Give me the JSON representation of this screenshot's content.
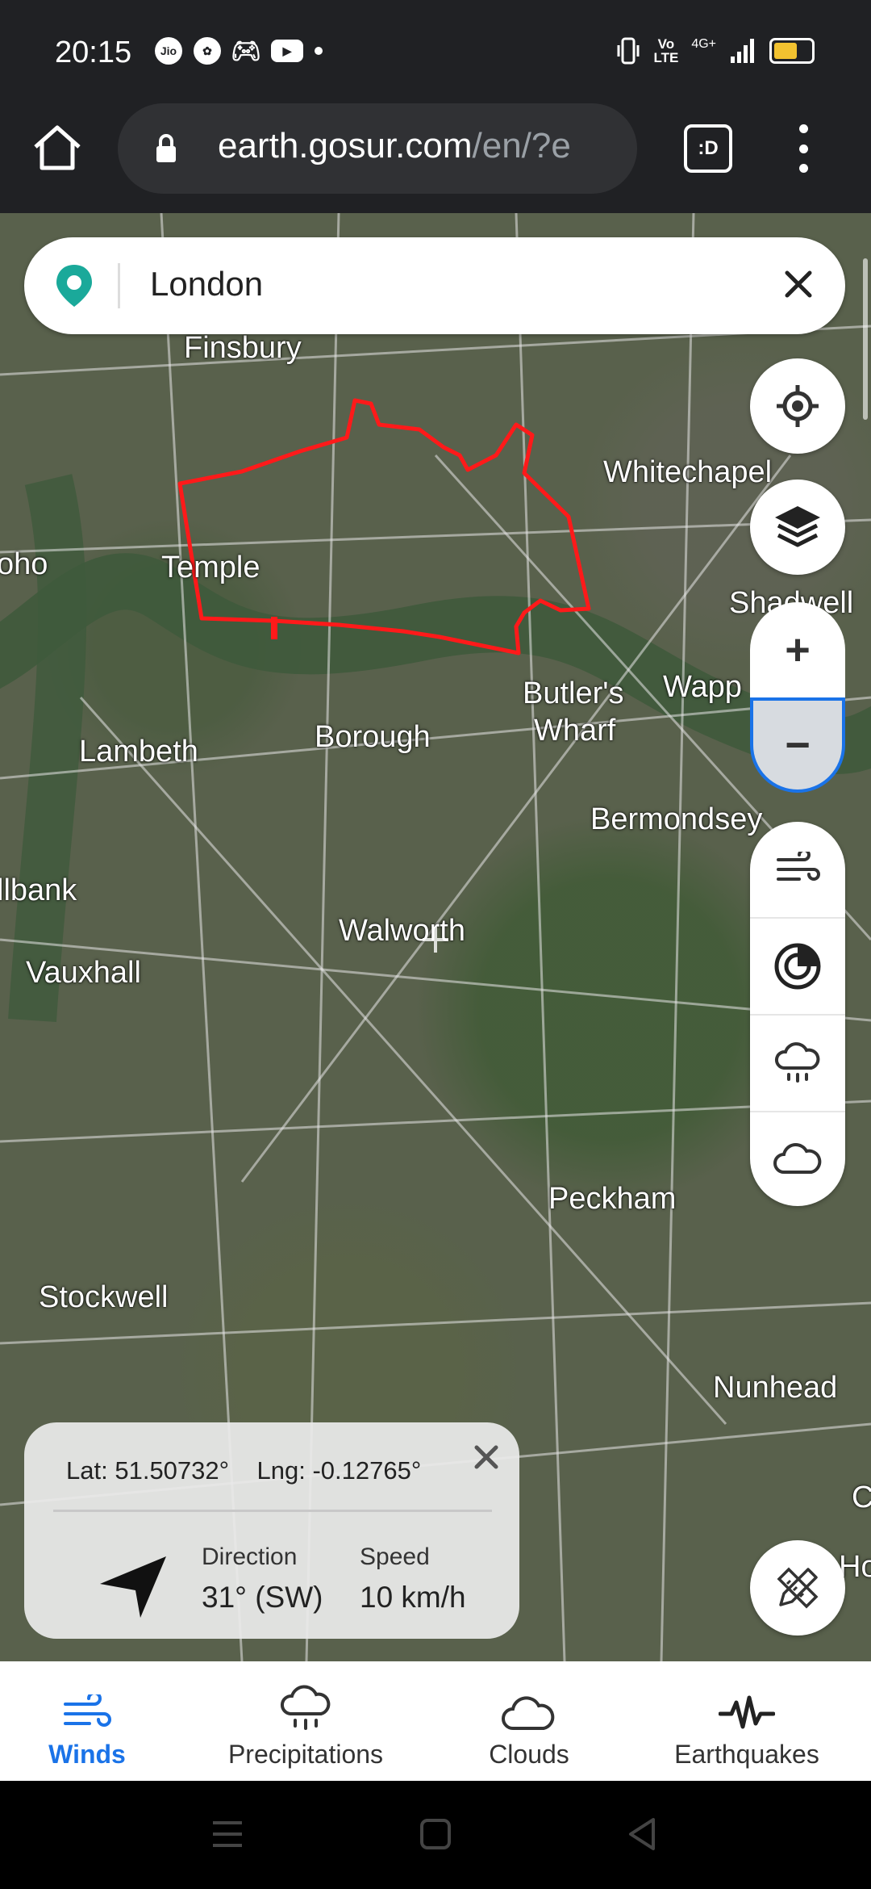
{
  "status_bar": {
    "time": "20:15",
    "network": "4G+",
    "icons": [
      "jio-icon",
      "settings-fan-icon",
      "gamepad-icon",
      "youtube-icon",
      "dot-icon"
    ],
    "right_icons": [
      "vibrate-icon",
      "volte-icon",
      "signal-icon",
      "battery-icon"
    ],
    "volte": "Vo\nLTE"
  },
  "browser": {
    "url_host": "earth.gosur.com",
    "url_path": "/en/?e",
    "tabs_label": ":D"
  },
  "search": {
    "query": "London"
  },
  "map": {
    "places": [
      {
        "id": "finsbury",
        "name": "Finsbury"
      },
      {
        "id": "whitechapel",
        "name": "Whitechapel"
      },
      {
        "id": "soho",
        "name": "oho"
      },
      {
        "id": "temple",
        "name": "Temple"
      },
      {
        "id": "shadwell",
        "name": "Shadwell"
      },
      {
        "id": "wapping",
        "name": "Wapp"
      },
      {
        "id": "butlers",
        "name": "Butler's"
      },
      {
        "id": "wharf",
        "name": "Wharf"
      },
      {
        "id": "lambeth",
        "name": "Lambeth"
      },
      {
        "id": "borough",
        "name": "Borough"
      },
      {
        "id": "bermondsey",
        "name": "Bermondsey"
      },
      {
        "id": "millbank",
        "name": "llbank"
      },
      {
        "id": "walworth",
        "name": "Walworth"
      },
      {
        "id": "vauxhall",
        "name": "Vauxhall"
      },
      {
        "id": "peckham",
        "name": "Peckham"
      },
      {
        "id": "stockwell",
        "name": "Stockwell"
      },
      {
        "id": "nunhead",
        "name": "Nunhead"
      },
      {
        "id": "edge_c",
        "name": "C"
      },
      {
        "id": "edge_ho",
        "name": "Ho"
      }
    ],
    "boundary_color": "#ff1a1a"
  },
  "controls": {
    "zoom_in": "+",
    "zoom_out": "−"
  },
  "info_card": {
    "lat_label": "Lat:",
    "lat": "51.50732°",
    "lng_label": "Lng:",
    "lng": "-0.12765°",
    "direction_label": "Direction",
    "direction_value": "31° (SW)",
    "speed_label": "Speed",
    "speed_value": "10 km/h"
  },
  "bottom_nav": {
    "items": [
      {
        "label": "Winds",
        "icon": "wind-icon",
        "active": true
      },
      {
        "label": "Precipitations",
        "icon": "rain-cloud-icon",
        "active": false
      },
      {
        "label": "Clouds",
        "icon": "cloud-icon",
        "active": false
      },
      {
        "label": "Earthquakes",
        "icon": "seismic-wave-icon",
        "active": false
      }
    ]
  },
  "colors": {
    "accent": "#1a73e8",
    "pin": "#1aa99a",
    "browser_bg": "#202124"
  }
}
